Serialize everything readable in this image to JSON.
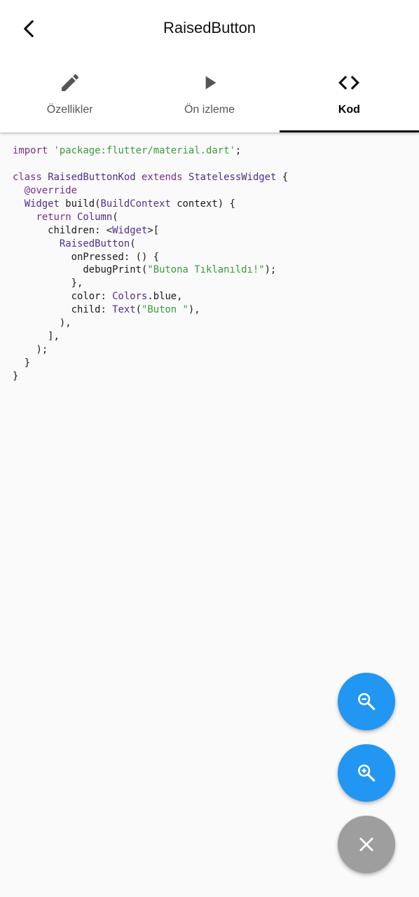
{
  "header": {
    "title": "RaisedButton",
    "back_icon": "arrow-back-icon"
  },
  "tabs": [
    {
      "label": "Özellikler",
      "icon": "edit-pencil-icon",
      "active": false
    },
    {
      "label": "Ön izleme",
      "icon": "play-icon",
      "active": false
    },
    {
      "label": "Kod",
      "icon": "code-icon",
      "active": true
    }
  ],
  "code": {
    "language": "dart",
    "lines": [
      [
        [
          "kw",
          "import"
        ],
        [
          "p",
          " "
        ],
        [
          "str",
          "'package:flutter/material.dart'"
        ],
        [
          "p",
          ";"
        ]
      ],
      [],
      [
        [
          "kw",
          "class"
        ],
        [
          "p",
          " "
        ],
        [
          "ty",
          "RaisedButtonKod"
        ],
        [
          "p",
          " "
        ],
        [
          "kw",
          "extends"
        ],
        [
          "p",
          " "
        ],
        [
          "ty",
          "StatelessWidget"
        ],
        [
          "p",
          " {"
        ]
      ],
      [
        [
          "p",
          "  "
        ],
        [
          "kw",
          "@override"
        ]
      ],
      [
        [
          "p",
          "  "
        ],
        [
          "ty",
          "Widget"
        ],
        [
          "p",
          " build("
        ],
        [
          "ty",
          "BuildContext"
        ],
        [
          "p",
          " context) {"
        ]
      ],
      [
        [
          "p",
          "    "
        ],
        [
          "kw",
          "return"
        ],
        [
          "p",
          " "
        ],
        [
          "ty",
          "Column"
        ],
        [
          "p",
          "("
        ]
      ],
      [
        [
          "p",
          "      children: <"
        ],
        [
          "ty",
          "Widget"
        ],
        [
          "p",
          ">["
        ]
      ],
      [
        [
          "p",
          "        "
        ],
        [
          "ty",
          "RaisedButton"
        ],
        [
          "p",
          "("
        ]
      ],
      [
        [
          "p",
          "          onPressed: () {"
        ]
      ],
      [
        [
          "p",
          "            debugPrint("
        ],
        [
          "str",
          "\"Butona Tıklanıldı!\""
        ],
        [
          "p",
          ");"
        ]
      ],
      [
        [
          "p",
          "          },"
        ]
      ],
      [
        [
          "p",
          "          color: "
        ],
        [
          "ty",
          "Colors"
        ],
        [
          "p",
          ".blue,"
        ]
      ],
      [
        [
          "p",
          "          child: "
        ],
        [
          "ty",
          "Text"
        ],
        [
          "p",
          "("
        ],
        [
          "str",
          "\"Buton \""
        ],
        [
          "p",
          "),"
        ]
      ],
      [
        [
          "p",
          "        ),"
        ]
      ],
      [
        [
          "p",
          "      ],"
        ]
      ],
      [
        [
          "p",
          "    );"
        ]
      ],
      [
        [
          "p",
          "  }"
        ]
      ],
      [
        [
          "p",
          "}"
        ]
      ]
    ]
  },
  "fabs": {
    "zoom_out_icon": "zoom-out-icon",
    "zoom_in_icon": "zoom-in-icon",
    "close_icon": "close-icon"
  },
  "colors": {
    "fab_blue": "#2196f3",
    "fab_grey": "#9e9e9e",
    "keyword": "#7a2d8e",
    "string": "#3c9a3c",
    "type": "#4f2f8f",
    "tab_indicator": "#111111"
  }
}
